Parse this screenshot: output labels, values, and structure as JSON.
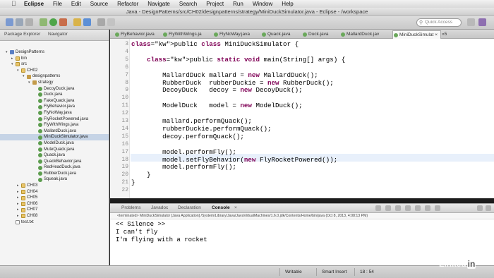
{
  "menubar": {
    "apple": "",
    "items": [
      "Eclipse",
      "File",
      "Edit",
      "Source",
      "Refactor",
      "Navigate",
      "Search",
      "Project",
      "Run",
      "Window",
      "Help"
    ]
  },
  "window": {
    "title": "Java - DesignPatterns/src/CH02/designpatterns/strategy/MiniDuckSimulator.java - Eclipse - /workspace"
  },
  "toolbar": {
    "quick_access_placeholder": "Quick Access"
  },
  "explorer": {
    "tabs": [
      "Package Explorer",
      "Navigator"
    ],
    "tree": [
      {
        "label": "DesignPatterns",
        "icon": "project",
        "depth": 0,
        "arrow": "▾"
      },
      {
        "label": "bin",
        "icon": "folder",
        "depth": 1,
        "arrow": "▸"
      },
      {
        "label": "src",
        "icon": "folder",
        "depth": 1,
        "arrow": "▾"
      },
      {
        "label": "CH02",
        "icon": "folder",
        "depth": 2,
        "arrow": "▾"
      },
      {
        "label": "designpatterns",
        "icon": "pkg",
        "depth": 3,
        "arrow": "▾"
      },
      {
        "label": "strategy",
        "icon": "pkg",
        "depth": 4,
        "arrow": "▾"
      },
      {
        "label": "DecoyDuck.java",
        "icon": "java",
        "depth": 5,
        "arrow": ""
      },
      {
        "label": "Duck.java",
        "icon": "java",
        "depth": 5,
        "arrow": ""
      },
      {
        "label": "FakeQuack.java",
        "icon": "java",
        "depth": 5,
        "arrow": ""
      },
      {
        "label": "FlyBehavior.java",
        "icon": "java",
        "depth": 5,
        "arrow": ""
      },
      {
        "label": "FlyNoWay.java",
        "icon": "java",
        "depth": 5,
        "arrow": ""
      },
      {
        "label": "FlyRocketPowered.java",
        "icon": "java",
        "depth": 5,
        "arrow": ""
      },
      {
        "label": "FlyWithWings.java",
        "icon": "java",
        "depth": 5,
        "arrow": ""
      },
      {
        "label": "MallardDuck.java",
        "icon": "java",
        "depth": 5,
        "arrow": ""
      },
      {
        "label": "MiniDuckSimulator.java",
        "icon": "java",
        "depth": 5,
        "arrow": "",
        "selected": true
      },
      {
        "label": "ModelDuck.java",
        "icon": "java",
        "depth": 5,
        "arrow": ""
      },
      {
        "label": "MuteQuack.java",
        "icon": "java",
        "depth": 5,
        "arrow": ""
      },
      {
        "label": "Quack.java",
        "icon": "java",
        "depth": 5,
        "arrow": ""
      },
      {
        "label": "QuackBehavior.java",
        "icon": "java",
        "depth": 5,
        "arrow": ""
      },
      {
        "label": "RedHeadDuck.java",
        "icon": "java",
        "depth": 5,
        "arrow": ""
      },
      {
        "label": "RubberDuck.java",
        "icon": "java",
        "depth": 5,
        "arrow": ""
      },
      {
        "label": "Squeak.java",
        "icon": "java",
        "depth": 5,
        "arrow": ""
      },
      {
        "label": "CH03",
        "icon": "folder",
        "depth": 2,
        "arrow": "▸"
      },
      {
        "label": "CH04",
        "icon": "folder",
        "depth": 2,
        "arrow": "▸"
      },
      {
        "label": "CH05",
        "icon": "folder",
        "depth": 2,
        "arrow": "▸"
      },
      {
        "label": "CH06",
        "icon": "folder",
        "depth": 2,
        "arrow": "▸"
      },
      {
        "label": "CH07",
        "icon": "folder",
        "depth": 2,
        "arrow": "▸"
      },
      {
        "label": "CH08",
        "icon": "folder",
        "depth": 2,
        "arrow": "▸"
      },
      {
        "label": "test.txt",
        "icon": "txt",
        "depth": 1,
        "arrow": ""
      }
    ]
  },
  "editor_tabs": [
    "FlyBehavior.java",
    "FlyWithWings.ja",
    "FlyNoWay.java",
    "Quack.java",
    "Duck.java",
    "MallardDuck.jav",
    "MiniDuckSimulat"
  ],
  "editor_tabs_overflow": "»5",
  "code": {
    "lines": [
      {
        "n": "3",
        "text": "public class MiniDuckSimulator {"
      },
      {
        "n": "4",
        "text": ""
      },
      {
        "n": "5",
        "text": "    public static void main(String[] args) {"
      },
      {
        "n": "6",
        "text": ""
      },
      {
        "n": "7",
        "text": "        MallardDuck mallard = new MallardDuck();"
      },
      {
        "n": "8",
        "text": "        RubberDuck  rubberDuckie = new RubberDuck();"
      },
      {
        "n": "9",
        "text": "        DecoyDuck   decoy = new DecoyDuck();"
      },
      {
        "n": "10",
        "text": ""
      },
      {
        "n": "11",
        "text": "        ModelDuck   model = new ModelDuck();"
      },
      {
        "n": "12",
        "text": ""
      },
      {
        "n": "13",
        "text": "        mallard.performQuack();"
      },
      {
        "n": "14",
        "text": "        rubberDuckie.performQuack();"
      },
      {
        "n": "15",
        "text": "        decoy.performQuack();"
      },
      {
        "n": "16",
        "text": ""
      },
      {
        "n": "17",
        "text": "        model.performFly();"
      },
      {
        "n": "18",
        "text": "        model.setFlyBehavior(new FlyRocketPowered());"
      },
      {
        "n": "19",
        "text": "        model.performFly();"
      },
      {
        "n": "20",
        "text": "    }"
      },
      {
        "n": "21",
        "text": "}"
      },
      {
        "n": "22",
        "text": ""
      }
    ]
  },
  "console": {
    "tabs": [
      "Problems",
      "Javadoc",
      "Declaration",
      "Console"
    ],
    "active_tab": "Console",
    "terminated_line": "<terminated> MiniDuckSimulator [Java Application] /System/Library/Java/JavaVirtualMachines/1.6.0.jdk/Contents/Home/bin/java (Oct 8, 2013, 4:08:13 PM)",
    "output": [
      "<< Silence >>",
      "I can't fly",
      "I'm flying with a rocket"
    ]
  },
  "status": {
    "writable": "Writable",
    "insert_mode": "Smart Insert",
    "position": "18 : 54"
  },
  "watermark": {
    "brand": "Linked",
    "brand_in": "in"
  }
}
